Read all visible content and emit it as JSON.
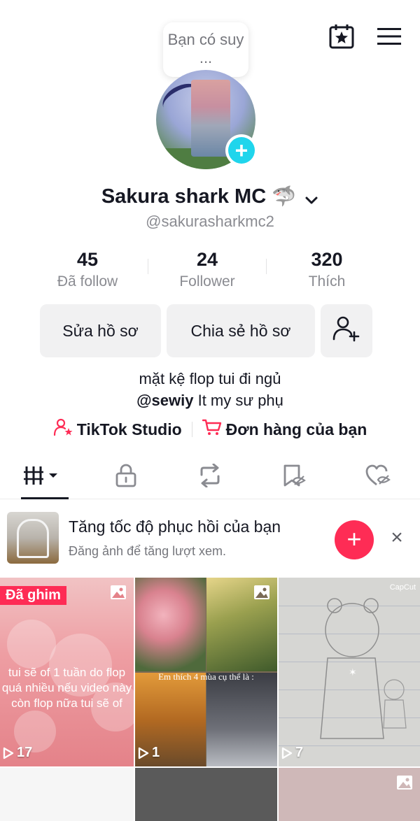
{
  "header": {
    "calendar_icon": "calendar-star-icon",
    "menu_icon": "hamburger-menu-icon"
  },
  "profile": {
    "bubble_text": "Bạn có suy ...",
    "name": "Sakura shark MC",
    "name_emoji": "🦈",
    "handle": "@sakurasharkmc2"
  },
  "stats": [
    {
      "value": "45",
      "label": "Đã follow"
    },
    {
      "value": "24",
      "label": "Follower"
    },
    {
      "value": "320",
      "label": "Thích"
    }
  ],
  "actions": {
    "edit_profile": "Sửa hồ sơ",
    "share_profile": "Chia sẻ hồ sơ"
  },
  "bio": {
    "line1": "mặt kệ flop tui đi ngủ",
    "mention": "@sewiy",
    "line2_rest": " It my sư phụ"
  },
  "links": {
    "studio": "TikTok Studio",
    "orders": "Đơn hàng của bạn"
  },
  "promo": {
    "title": "Tăng tốc độ phục hồi của bạn",
    "subtitle": "Đăng ảnh để tăng lượt xem.",
    "add": "+",
    "close": "×"
  },
  "grid": {
    "pinned_label": "Đã ghim",
    "c1_text": "tui sẽ of 1 tuần do flop quá nhiều nếu video này còn flop nữa tui sẽ of",
    "c1_views": "17",
    "c2_caption": "Em thích 4 mùa cụ thể là :",
    "c2_views": "1",
    "c3_brand": "CapCut",
    "c3_views": "7"
  },
  "colors": {
    "accent": "#fe2c55",
    "badge": "#20d5ec",
    "text_primary": "#161823",
    "text_secondary": "#8a8b91"
  }
}
